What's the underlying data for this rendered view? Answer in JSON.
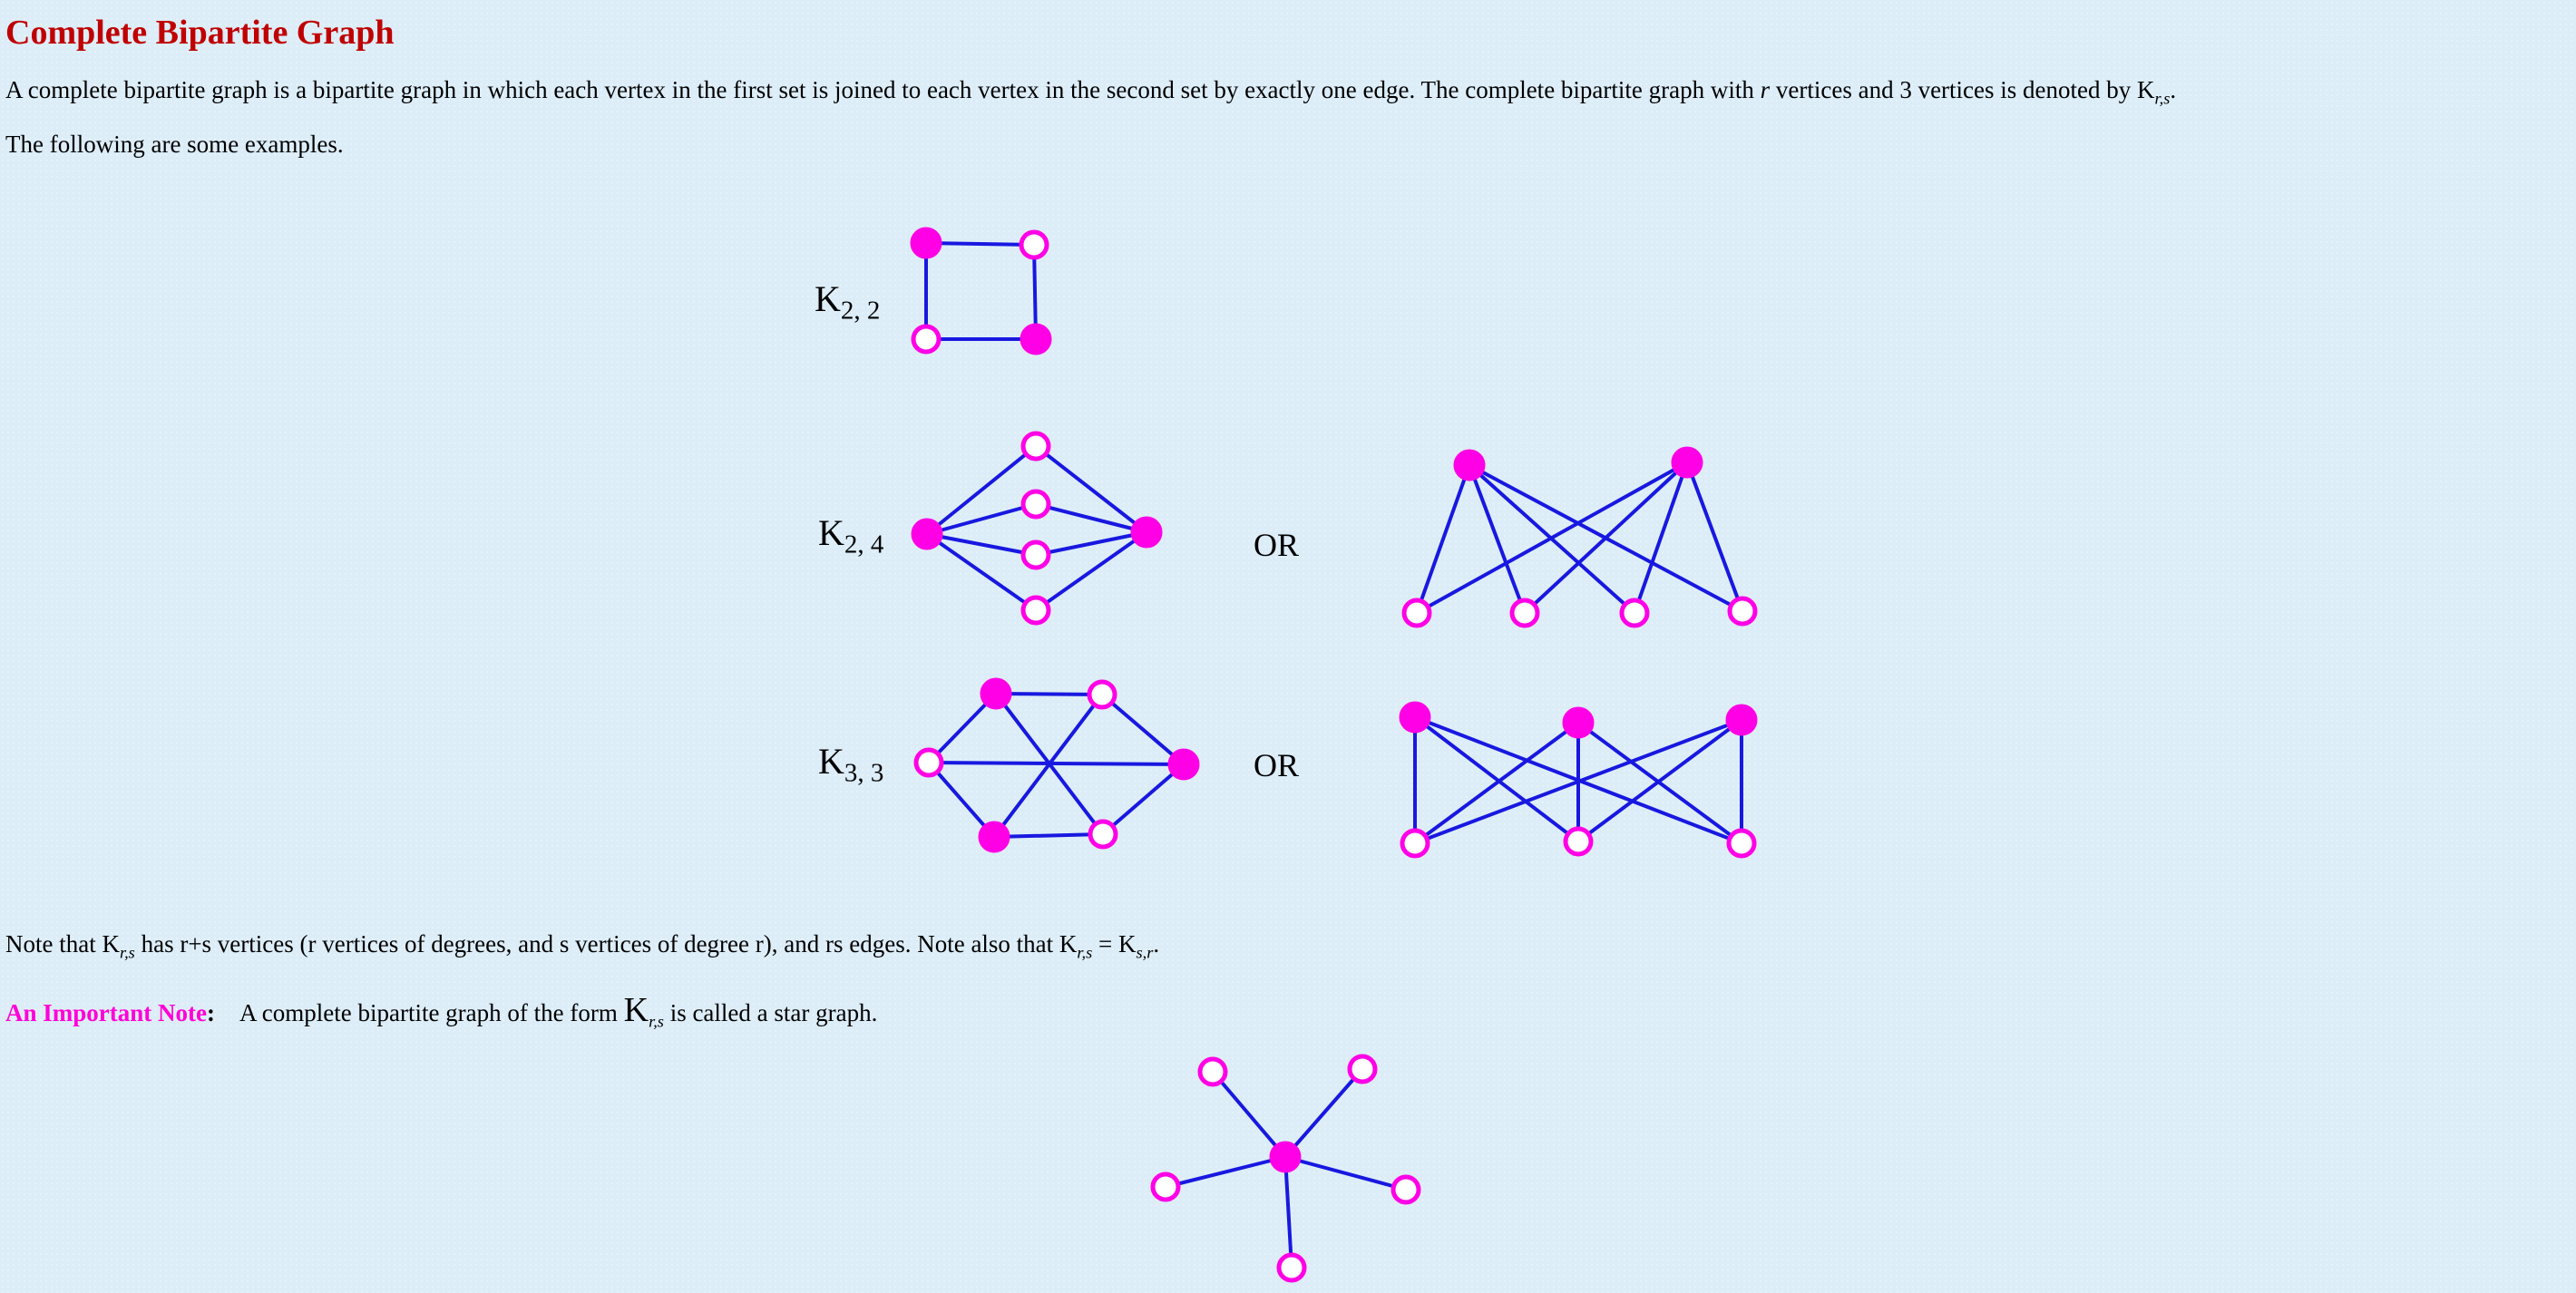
{
  "title": "Complete Bipartite Graph",
  "intro": {
    "part1": "A complete bipartite graph is a bipartite graph in which each vertex in the first set is joined to each vertex in the second set  by exactly one edge. The complete bipartite graph with ",
    "r": "r",
    "part2": " vertices and 3 vertices is denoted by K",
    "sub": "r,s",
    "end": "."
  },
  "examples_text": "The following are some examples.",
  "graph_labels": [
    {
      "k": "K",
      "sub": "2, 2"
    },
    {
      "k": "K",
      "sub": "2, 4"
    },
    {
      "k": "K",
      "sub": "3, 3"
    }
  ],
  "or_label": "OR",
  "note": {
    "part1": "Note that K",
    "sub1": "r,s",
    "part2": " has r+s vertices (r vertices of degrees, and s vertices of degree r), and rs edges. Note also that  K",
    "sub2": "r,s",
    "part3": " = K",
    "sub3": "s,r",
    "end": "."
  },
  "important": {
    "label": "An Important Note",
    "colon": ":",
    "part1": "A complete bipartite graph of the form ",
    "k": "K",
    "sub": "r,s",
    "part2": " is called a star graph."
  },
  "colors": {
    "title": "#c00000",
    "vertex": "#ff00e6",
    "edge": "#1818e0",
    "note_label": "#ff00d8"
  },
  "graphs": [
    {
      "name": "k22",
      "vertices": [
        {
          "id": "a",
          "filled": true
        },
        {
          "id": "b",
          "filled": false
        },
        {
          "id": "c",
          "filled": false
        },
        {
          "id": "d",
          "filled": true
        }
      ],
      "edges": [
        [
          "a",
          "b"
        ],
        [
          "a",
          "c"
        ],
        [
          "b",
          "d"
        ],
        [
          "c",
          "d"
        ]
      ]
    },
    {
      "name": "k24",
      "vertices": [
        {
          "id": "L",
          "filled": true
        },
        {
          "id": "R",
          "filled": true
        },
        {
          "id": "m1",
          "filled": false
        },
        {
          "id": "m2",
          "filled": false
        },
        {
          "id": "m3",
          "filled": false
        },
        {
          "id": "m4",
          "filled": false
        }
      ],
      "edges": [
        [
          "L",
          "m1"
        ],
        [
          "L",
          "m2"
        ],
        [
          "L",
          "m3"
        ],
        [
          "L",
          "m4"
        ],
        [
          "R",
          "m1"
        ],
        [
          "R",
          "m2"
        ],
        [
          "R",
          "m3"
        ],
        [
          "R",
          "m4"
        ]
      ]
    },
    {
      "name": "k24-alt",
      "vertices": [
        {
          "id": "t1",
          "filled": true
        },
        {
          "id": "t2",
          "filled": true
        },
        {
          "id": "b1",
          "filled": false
        },
        {
          "id": "b2",
          "filled": false
        },
        {
          "id": "b3",
          "filled": false
        },
        {
          "id": "b4",
          "filled": false
        }
      ],
      "edges": [
        [
          "t1",
          "b1"
        ],
        [
          "t1",
          "b2"
        ],
        [
          "t1",
          "b3"
        ],
        [
          "t1",
          "b4"
        ],
        [
          "t2",
          "b1"
        ],
        [
          "t2",
          "b2"
        ],
        [
          "t2",
          "b3"
        ],
        [
          "t2",
          "b4"
        ]
      ]
    },
    {
      "name": "k33",
      "vertices": [
        {
          "id": "ul",
          "filled": true
        },
        {
          "id": "ur",
          "filled": false
        },
        {
          "id": "l",
          "filled": false
        },
        {
          "id": "r",
          "filled": true
        },
        {
          "id": "ll",
          "filled": true
        },
        {
          "id": "lr",
          "filled": false
        }
      ],
      "edges": [
        [
          "ul",
          "ur"
        ],
        [
          "ul",
          "l"
        ],
        [
          "ul",
          "lr"
        ],
        [
          "ur",
          "r"
        ],
        [
          "ur",
          "ll"
        ],
        [
          "l",
          "r"
        ],
        [
          "l",
          "ll"
        ],
        [
          "ll",
          "lr"
        ],
        [
          "lr",
          "r"
        ]
      ]
    },
    {
      "name": "k33-alt",
      "vertices": [
        {
          "id": "t1",
          "filled": true
        },
        {
          "id": "t2",
          "filled": true
        },
        {
          "id": "t3",
          "filled": true
        },
        {
          "id": "b1",
          "filled": false
        },
        {
          "id": "b2",
          "filled": false
        },
        {
          "id": "b3",
          "filled": false
        }
      ],
      "edges": [
        [
          "t1",
          "b1"
        ],
        [
          "t1",
          "b2"
        ],
        [
          "t1",
          "b3"
        ],
        [
          "t2",
          "b1"
        ],
        [
          "t2",
          "b2"
        ],
        [
          "t2",
          "b3"
        ],
        [
          "t3",
          "b1"
        ],
        [
          "t3",
          "b2"
        ],
        [
          "t3",
          "b3"
        ]
      ]
    },
    {
      "name": "star",
      "vertices": [
        {
          "id": "c",
          "filled": true
        },
        {
          "id": "o1",
          "filled": false
        },
        {
          "id": "o2",
          "filled": false
        },
        {
          "id": "o3",
          "filled": false
        },
        {
          "id": "o4",
          "filled": false
        },
        {
          "id": "o5",
          "filled": false
        }
      ],
      "edges": [
        [
          "c",
          "o1"
        ],
        [
          "c",
          "o2"
        ],
        [
          "c",
          "o3"
        ],
        [
          "c",
          "o4"
        ],
        [
          "c",
          "o5"
        ]
      ]
    }
  ]
}
